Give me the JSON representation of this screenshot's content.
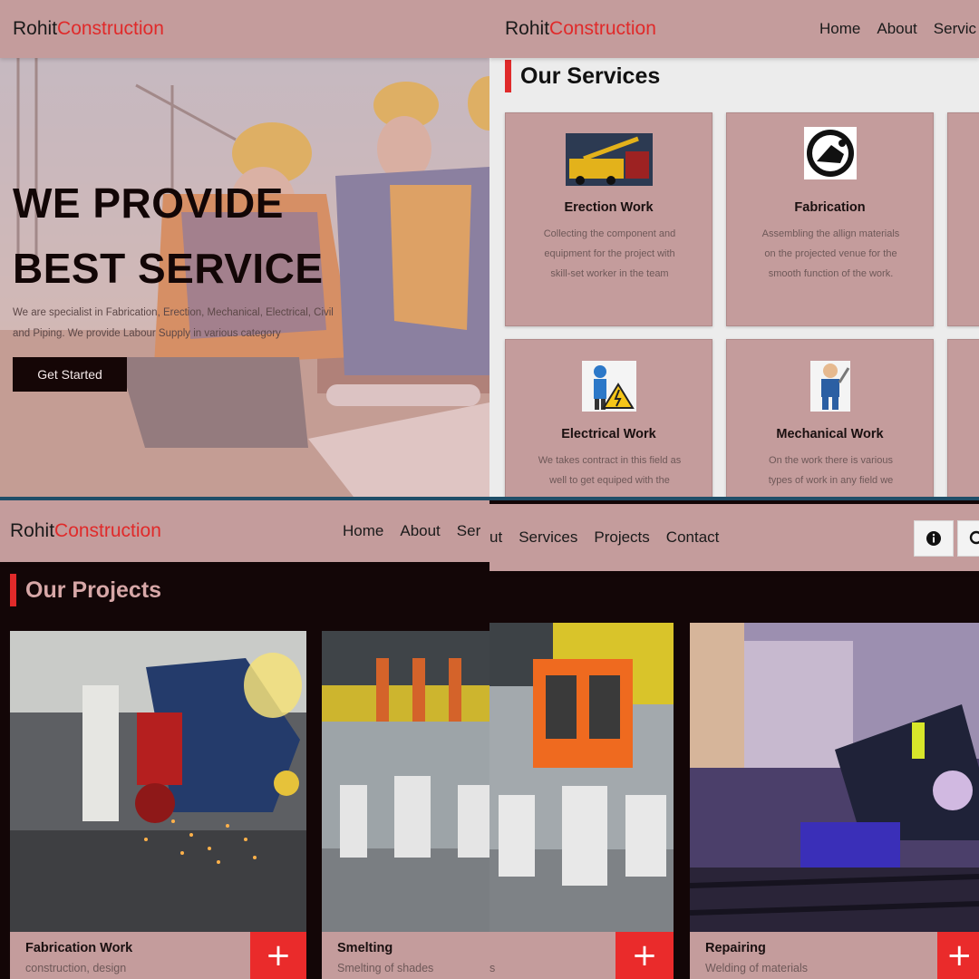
{
  "brand": {
    "first": "Rohit",
    "second": "Construction"
  },
  "nav": {
    "top_right": [
      "Home",
      "About",
      "Servic"
    ],
    "bottom_left": [
      "Home",
      "About",
      "Ser"
    ],
    "bottom_right_partial": "ut",
    "bottom_right": [
      "Services",
      "Projects",
      "Contact"
    ]
  },
  "hero": {
    "title_line1": "WE PROVIDE",
    "title_line2": "BEST SERVICE",
    "desc_line1": "We are specialist in Fabrication, Erection, Mechanical, Electrical, Civil",
    "desc_line2": "and Piping. We provide Labour Supply in various category",
    "button": "Get Started"
  },
  "services": {
    "heading": "Our Services",
    "cards": [
      {
        "title": "Erection Work",
        "desc_lines": [
          "Collecting the component and",
          "equipment for the project with",
          "skill-set worker in the team"
        ],
        "icon": "crane-photo-icon"
      },
      {
        "title": "Fabrication",
        "desc_lines": [
          "Assembling the allign materials",
          "on the projected venue for the",
          "smooth function of the work."
        ],
        "icon": "welder-emblem-icon"
      },
      {
        "title": "Electrical Work",
        "desc_lines": [
          "We takes contract in this field as",
          "well to get equiped with the"
        ],
        "icon": "electrician-warning-icon"
      },
      {
        "title": "Mechanical Work",
        "desc_lines": [
          "On the work there is various",
          "types of work in any field we"
        ],
        "icon": "mechanic-worker-icon"
      }
    ]
  },
  "projects": {
    "heading": "Our Projects",
    "items": [
      {
        "title": "Fabrication Work",
        "sub": "construction, design"
      },
      {
        "title": "Smelting",
        "sub": "Smelting of shades"
      },
      {
        "title": "",
        "sub": "s"
      },
      {
        "title": "Repairing",
        "sub": "Welding of materials"
      }
    ],
    "plus": "+"
  },
  "colors": {
    "accent": "#e02a2a",
    "nav_bg": "#c49c9c",
    "dark_bg": "#130607",
    "light_bg": "#ececec",
    "divider": "#1f4e68"
  }
}
